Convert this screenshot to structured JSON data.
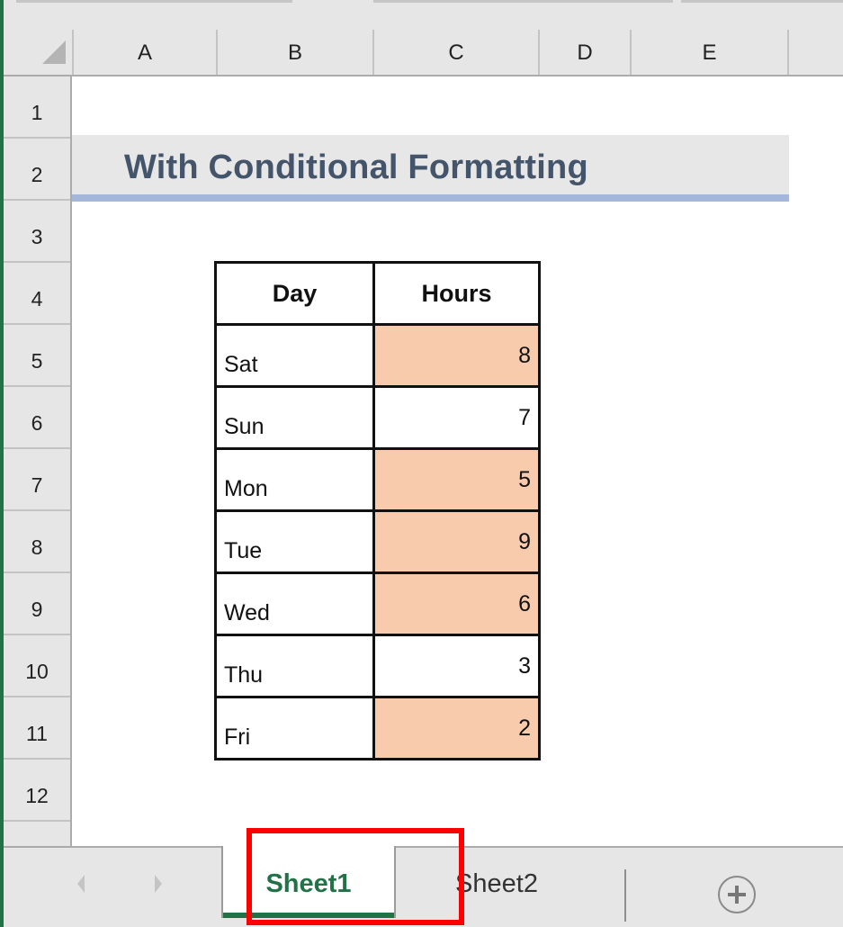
{
  "spreadsheet": {
    "columns": [
      "A",
      "B",
      "C",
      "D",
      "E"
    ],
    "rows": [
      "1",
      "2",
      "3",
      "4",
      "5",
      "6",
      "7",
      "8",
      "9",
      "10",
      "11",
      "12"
    ]
  },
  "title": {
    "text": "With Conditional Formatting",
    "text_color": "#44546a",
    "band_color": "#e7e7e7",
    "underline_color": "#a5b6db"
  },
  "table": {
    "headers": {
      "day": "Day",
      "hours": "Hours"
    },
    "highlight_color": "#f8cbad",
    "rows": [
      {
        "day": "Sat",
        "hours": "8",
        "highlighted": true
      },
      {
        "day": "Sun",
        "hours": "7",
        "highlighted": false
      },
      {
        "day": "Mon",
        "hours": "5",
        "highlighted": true
      },
      {
        "day": "Tue",
        "hours": "9",
        "highlighted": true
      },
      {
        "day": "Wed",
        "hours": "6",
        "highlighted": true
      },
      {
        "day": "Thu",
        "hours": "3",
        "highlighted": false
      },
      {
        "day": "Fri",
        "hours": "2",
        "highlighted": true
      }
    ]
  },
  "sheet_tabs": {
    "tabs": [
      {
        "label": "Sheet1",
        "active": true
      },
      {
        "label": "Sheet2",
        "active": false
      }
    ],
    "accent_color": "#217346",
    "nav_prev_icon": "triangle-left",
    "nav_next_icon": "triangle-right",
    "add_sheet_icon": "circle-plus",
    "annotation_color": "#ff0000"
  }
}
